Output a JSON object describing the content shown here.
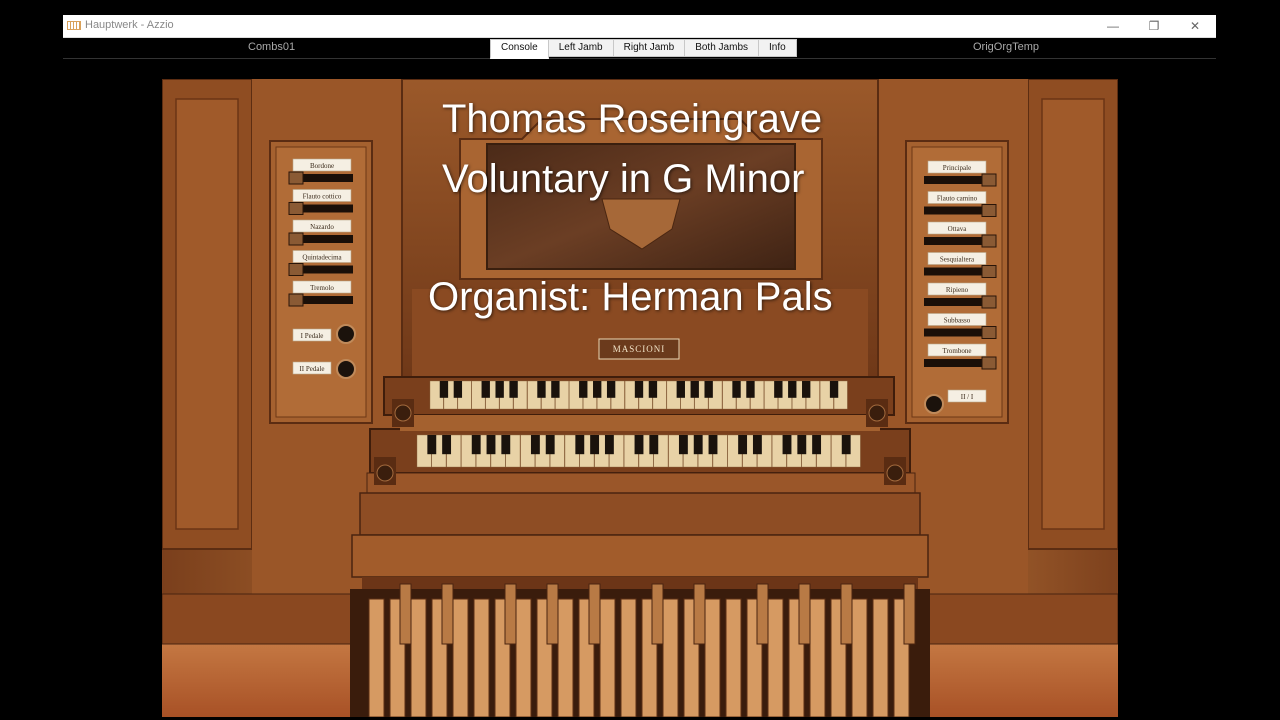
{
  "window": {
    "title": "Hauptwerk - Azzio",
    "controls": {
      "minimize": "—",
      "maximize": "❐",
      "close": "✕"
    }
  },
  "menubar": {
    "left_combination": "Combs01",
    "right_temperament": "OrigOrgTemp",
    "tabs": [
      {
        "label": "Console",
        "active": true
      },
      {
        "label": "Left Jamb",
        "active": false
      },
      {
        "label": "Right Jamb",
        "active": false
      },
      {
        "label": "Both Jambs",
        "active": false
      },
      {
        "label": "Info",
        "active": false
      }
    ]
  },
  "overlay": {
    "line1": "Thomas Roseingrave",
    "line2": "Voluntary in G Minor",
    "line3": "Organist: Herman Pals"
  },
  "console": {
    "builder_plaque": "MASCIONI",
    "left_jamb_stops": [
      "Bordone",
      "Flauto cottico",
      "Nazardo",
      "Quintadecima",
      "Tremolo"
    ],
    "left_jamb_couplers": [
      "I Pedale",
      "II Pedale"
    ],
    "right_jamb_stops": [
      "Principale",
      "Flauto camino",
      "Ottava",
      "Sesquialtera",
      "Ripieno",
      "Subbasso",
      "Trombone"
    ],
    "right_jamb_coupler": "II / I"
  },
  "colors": {
    "wood_dark": "#6e3b1a",
    "wood_mid": "#9a5a2c",
    "wood_light": "#c17a44",
    "key_natural": "#e8d2a6",
    "key_sharp": "#1a120c",
    "floor": "#b5642f"
  }
}
